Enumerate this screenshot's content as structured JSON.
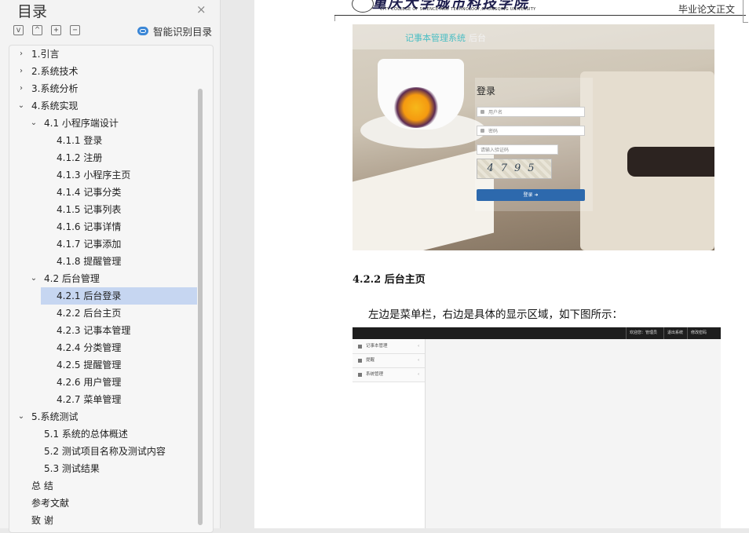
{
  "toc": {
    "title": "目录",
    "close_glyph": "×",
    "tools": {
      "collapse_glyph": "v",
      "expand_glyph": "^",
      "add_glyph": "+",
      "remove_glyph": "−"
    },
    "smart_label": "智能识别目录",
    "items": [
      {
        "label": "1.引言",
        "level": 1,
        "arrow": "›",
        "selected": false
      },
      {
        "label": "2.系统技术",
        "level": 1,
        "arrow": "›",
        "selected": false
      },
      {
        "label": "3.系统分析",
        "level": 1,
        "arrow": "›",
        "selected": false
      },
      {
        "label": "4.系统实现",
        "level": 1,
        "arrow": "⌄",
        "selected": false
      },
      {
        "label": "4.1 小程序端设计",
        "level": 2,
        "arrow": "⌄",
        "selected": false
      },
      {
        "label": "4.1.1 登录",
        "level": 3,
        "arrow": "",
        "selected": false
      },
      {
        "label": "4.1.2 注册",
        "level": 3,
        "arrow": "",
        "selected": false
      },
      {
        "label": "4.1.3 小程序主页",
        "level": 3,
        "arrow": "",
        "selected": false
      },
      {
        "label": "4.1.4 记事分类",
        "level": 3,
        "arrow": "",
        "selected": false
      },
      {
        "label": "4.1.5 记事列表",
        "level": 3,
        "arrow": "",
        "selected": false
      },
      {
        "label": "4.1.6 记事详情",
        "level": 3,
        "arrow": "",
        "selected": false
      },
      {
        "label": "4.1.7 记事添加",
        "level": 3,
        "arrow": "",
        "selected": false
      },
      {
        "label": "4.1.8 提醒管理",
        "level": 3,
        "arrow": "",
        "selected": false
      },
      {
        "label": "4.2 后台管理",
        "level": 2,
        "arrow": "⌄",
        "selected": false
      },
      {
        "label": "4.2.1 后台登录",
        "level": 3,
        "arrow": "",
        "selected": true
      },
      {
        "label": "4.2.2 后台主页",
        "level": 3,
        "arrow": "",
        "selected": false
      },
      {
        "label": "4.2.3 记事本管理",
        "level": 3,
        "arrow": "",
        "selected": false
      },
      {
        "label": "4.2.4 分类管理",
        "level": 3,
        "arrow": "",
        "selected": false
      },
      {
        "label": "4.2.5 提醒管理",
        "level": 3,
        "arrow": "",
        "selected": false
      },
      {
        "label": "4.2.6 用户管理",
        "level": 3,
        "arrow": "",
        "selected": false
      },
      {
        "label": "4.2.7 菜单管理",
        "level": 3,
        "arrow": "",
        "selected": false
      },
      {
        "label": "5.系统测试",
        "level": 1,
        "arrow": "⌄",
        "selected": false
      },
      {
        "label": "5.1 系统的总体概述",
        "level": 2,
        "arrow": "",
        "selected": false
      },
      {
        "label": "5.2 测试项目名称及测试内容",
        "level": 2,
        "arrow": "",
        "selected": false
      },
      {
        "label": "5.3 测试结果",
        "level": 2,
        "arrow": "",
        "selected": false
      },
      {
        "label": "总  结",
        "level": 1,
        "arrow": "",
        "selected": false
      },
      {
        "label": "参考文献",
        "level": 1,
        "arrow": "",
        "selected": false
      },
      {
        "label": "致    谢",
        "level": 1,
        "arrow": "",
        "selected": false
      }
    ]
  },
  "doc": {
    "header_cn": "重庆大学城市科技学院",
    "header_en": "CITY COLLEGE OF SCIENCE AND TECHNOLOGY,CHONGQING UNIVERSITY",
    "header_right": "毕业论文正文",
    "login_shot": {
      "app_name": "记事本管理系统",
      "app_suffix": "后台",
      "title": "登录",
      "username_placeholder": "用户名",
      "password_placeholder": "密码",
      "captcha_placeholder": "请输入验证码",
      "captcha_text": "4795",
      "button": "登录 ➜"
    },
    "heading": "4.2.2 后台主页",
    "paragraph": "左边是菜单栏，右边是具体的显示区域，如下图所示：",
    "admin_shot": {
      "top_links": [
        "欢迎您：管理员",
        "退出系统",
        "修改密码"
      ],
      "menu": [
        {
          "label": "记事本管理",
          "arrow": "‹"
        },
        {
          "label": "提醒",
          "arrow": "‹"
        },
        {
          "label": "系统管理",
          "arrow": "‹"
        }
      ]
    }
  }
}
